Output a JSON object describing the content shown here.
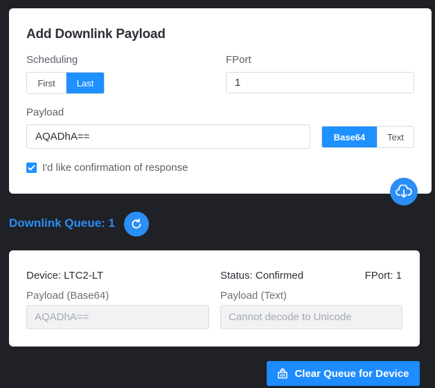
{
  "add_payload": {
    "title": "Add Downlink Payload",
    "scheduling_label": "Scheduling",
    "scheduling_options": [
      "First",
      "Last"
    ],
    "scheduling_selected": "Last",
    "fport_label": "FPort",
    "fport_value": "1",
    "payload_label": "Payload",
    "payload_value": "AQADhA==",
    "encoding_options": [
      "Base64",
      "Text"
    ],
    "encoding_selected": "Base64",
    "confirmation_label": "I'd like confirmation of response",
    "confirmation_checked": true
  },
  "queue": {
    "title": "Downlink Queue: 1",
    "items": [
      {
        "device": "Device: LTC2-LT",
        "status": "Status: Confirmed",
        "fport": "FPort: 1",
        "payload_base64_label": "Payload (Base64)",
        "payload_base64_value": "AQADhA==",
        "payload_text_label": "Payload (Text)",
        "payload_text_value": "Cannot decode to Unicode"
      }
    ],
    "clear_button_label": "Clear Queue for Device"
  },
  "icons": {
    "download": "cloud-download-icon",
    "refresh": "refresh-icon",
    "clear": "clear-queue-icon"
  },
  "colors": {
    "accent": "#1e90ff",
    "background": "#1f2126"
  }
}
